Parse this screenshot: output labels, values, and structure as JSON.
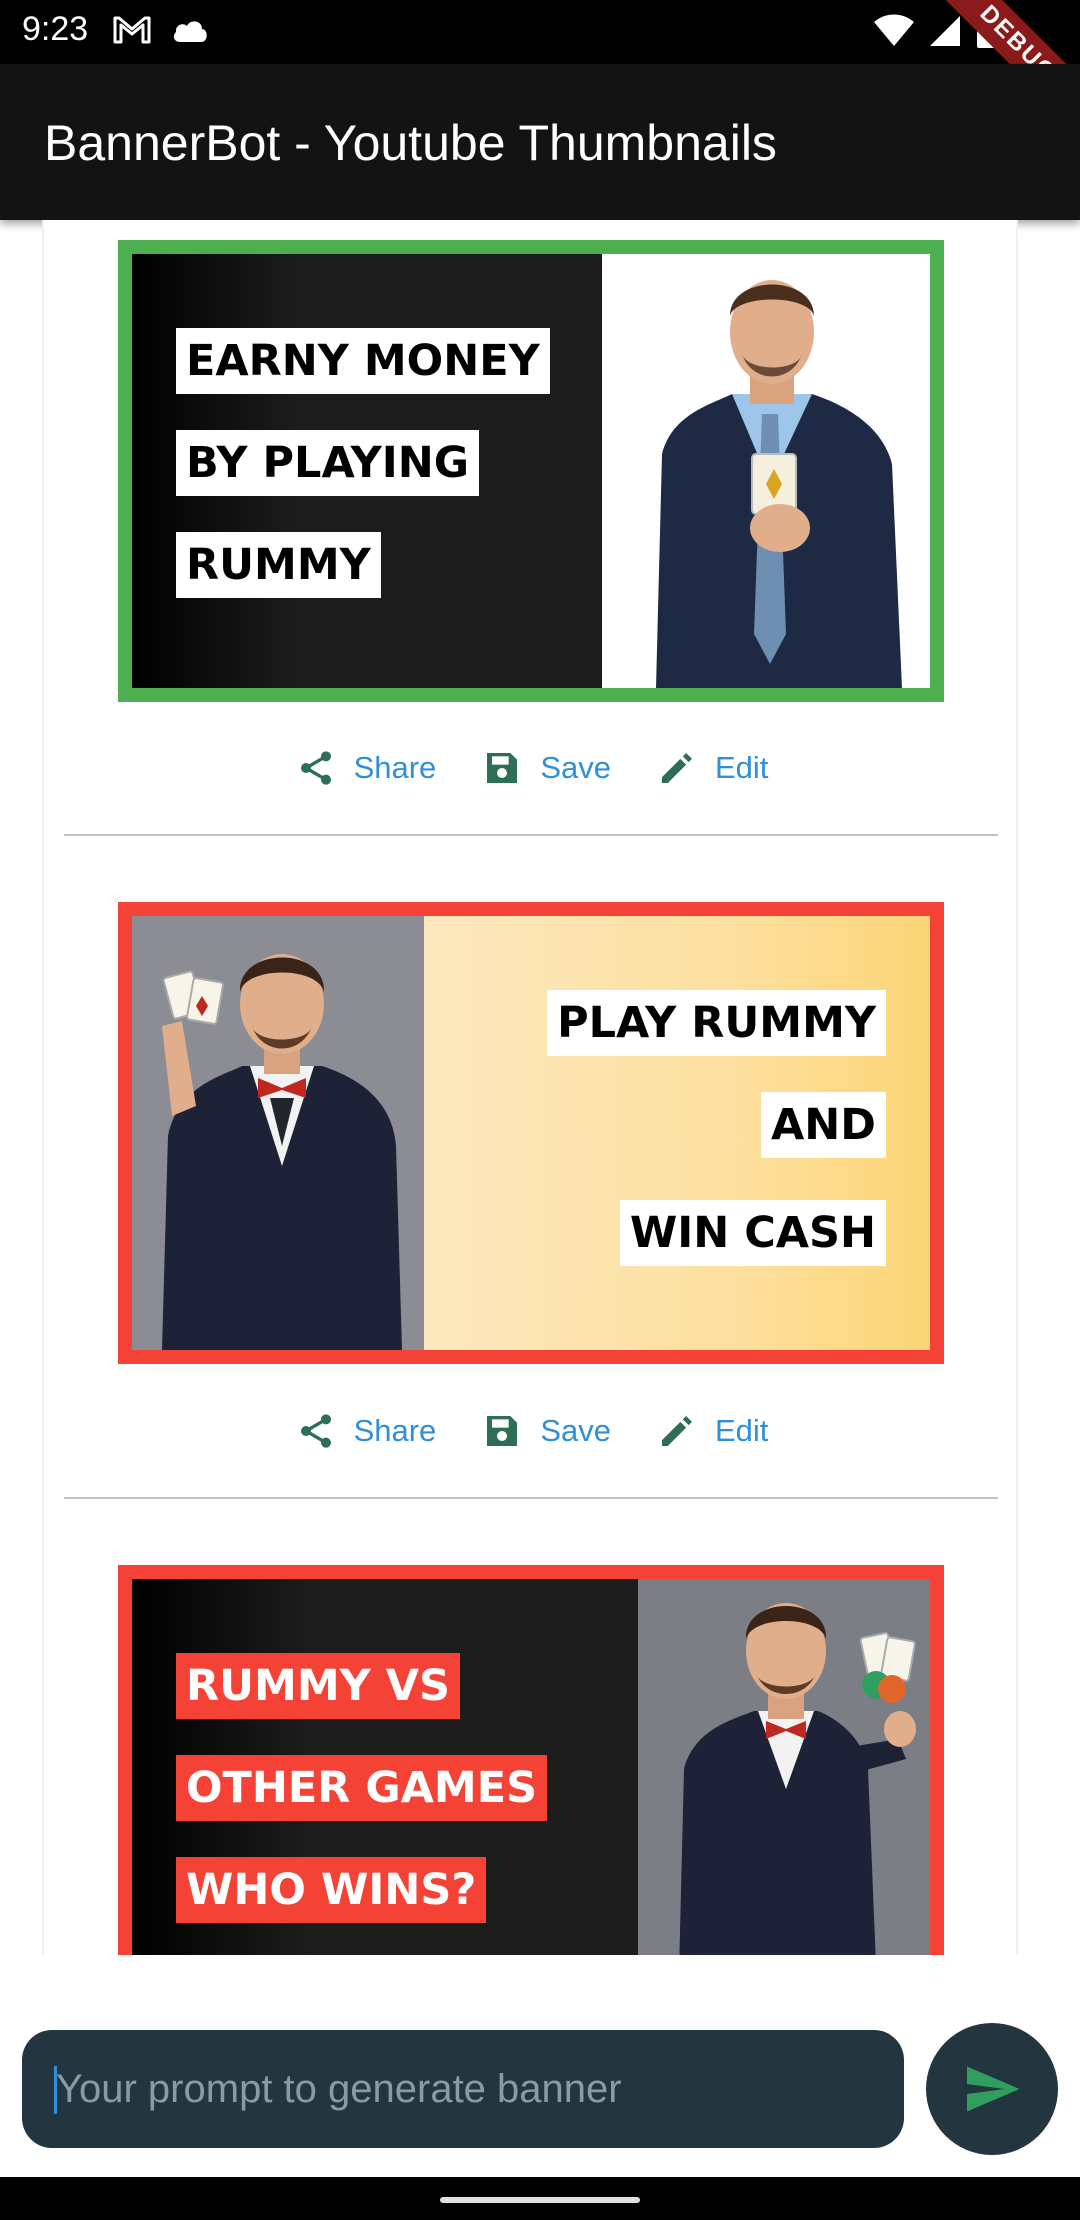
{
  "status_bar": {
    "time": "9:23",
    "left_icons": [
      "gmail-icon",
      "cloud-icon"
    ],
    "right_icons": [
      "wifi-icon",
      "signal-icon",
      "battery-icon"
    ],
    "debug_label": "DEBUG"
  },
  "app_bar": {
    "title": "BannerBot - Youtube Thumbnails"
  },
  "banners": [
    {
      "border_color": "#4caf50",
      "label_bg": "#ffffff",
      "label_color": "#000000",
      "lines": [
        "EARNY MONEY",
        "BY PLAYING",
        "RUMMY"
      ],
      "image": "man-holding-ace-card"
    },
    {
      "border_color": "#f44336",
      "label_bg": "#ffffff",
      "label_color": "#000000",
      "lines": [
        "PLAY RUMMY",
        "AND",
        "WIN CASH"
      ],
      "image": "man-with-cards-and-bowtie"
    },
    {
      "border_color": "#f44336",
      "label_bg": "#f44336",
      "label_color": "#ffffff",
      "lines": [
        "RUMMY VS",
        "OTHER GAMES",
        "WHO WINS?"
      ],
      "image": "man-holding-cards-and-chips"
    }
  ],
  "actions": {
    "share_label": "Share",
    "save_label": "Save",
    "edit_label": "Edit",
    "icon_color": "#2e6e55",
    "text_color": "#2f8fd8"
  },
  "prompt": {
    "placeholder": "Your prompt to generate banner"
  },
  "send_icon_color": "#2f9e5e"
}
